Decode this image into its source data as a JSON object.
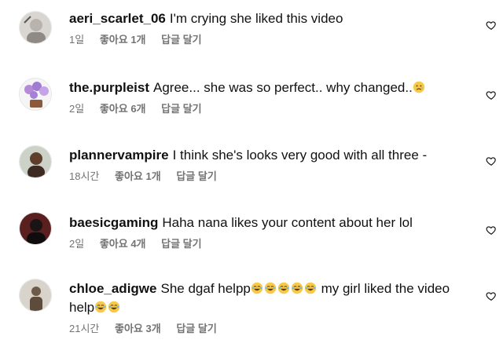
{
  "comments": [
    {
      "username": "aeri_scarlet_06",
      "text": "I'm crying she liked this video",
      "time": "1일",
      "likes": "좋아요 1개",
      "reply": "답글 달기",
      "like_icon": "heart-outline-icon"
    },
    {
      "username": "the.purpleist",
      "text": "Agree... she was so perfect.. why changed..",
      "time": "2일",
      "likes": "좋아요 6개",
      "reply": "답글 달기",
      "like_icon": "heart-outline-icon",
      "emoji": "disappointed-face-emoji"
    },
    {
      "username": "plannervampire",
      "text": "I think she's looks very good with all three -",
      "time": "18시간",
      "likes": "좋아요 1개",
      "reply": "답글 달기",
      "like_icon": "heart-outline-icon"
    },
    {
      "username": "baesicgaming",
      "text": "Haha nana likes your content about her lol",
      "time": "2일",
      "likes": "좋아요 4개",
      "reply": "답글 달기",
      "like_icon": "heart-outline-icon"
    },
    {
      "username": "chloe_adigwe",
      "text_part1": "She dgaf helpp",
      "text_part2": " my girl liked the video help",
      "time": "21시간",
      "likes": "좋아요 3개",
      "reply": "답글 달기",
      "like_icon": "heart-outline-icon",
      "emoji": "laughing-crying-face-emoji"
    }
  ]
}
